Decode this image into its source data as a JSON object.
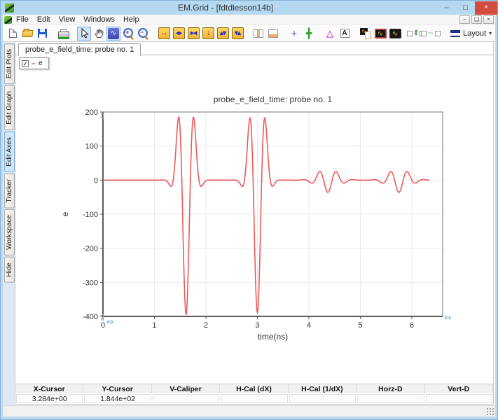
{
  "window": {
    "title": "EM.Grid - [fdtdlesson14b]",
    "controls": {
      "minimize": "–",
      "maximize": "□",
      "close": "×"
    }
  },
  "menubar": {
    "items": [
      "File",
      "Edit",
      "View",
      "Windows",
      "Help"
    ],
    "mdi_controls": {
      "minimize": "–",
      "restore": "❏",
      "close": "×"
    }
  },
  "toolbar": {
    "layout_label": "Layout",
    "layout_caret": "▾",
    "icons": [
      {
        "name": "new-file-icon",
        "kind": "page"
      },
      {
        "name": "open-file-icon",
        "kind": "folder"
      },
      {
        "name": "save-icon",
        "kind": "floppy"
      },
      {
        "name": "print-icon",
        "kind": "printer",
        "gap": true
      },
      {
        "name": "select-cursor-icon",
        "kind": "svg-cursor",
        "selected": true,
        "gap": true
      },
      {
        "name": "pan-hand-icon",
        "kind": "svg-hand"
      },
      {
        "name": "zoom-region-icon",
        "kind": "wavebox",
        "glyph": "∿",
        "selected": true
      },
      {
        "name": "zoom-in-icon",
        "kind": "zoom",
        "glyph": "+"
      },
      {
        "name": "zoom-out-icon",
        "kind": "zoom",
        "glyph": "−"
      },
      {
        "name": "expand-x-icon",
        "kind": "yl",
        "glyph": "↔",
        "color": "#c42222",
        "gap": true
      },
      {
        "name": "shrink-x-icon",
        "kind": "yl",
        "glyph": "◂▸",
        "color": "#2233bb"
      },
      {
        "name": "compress-x-icon",
        "kind": "yl",
        "glyph": "▸◂",
        "color": "#2233bb"
      },
      {
        "name": "expand-y-icon",
        "kind": "yl",
        "glyph": "↕",
        "color": "#c42222"
      },
      {
        "name": "shrink-y-icon",
        "kind": "yl",
        "glyph": "▴▾",
        "color": "#2233bb"
      },
      {
        "name": "compress-y-icon",
        "kind": "yl",
        "glyph": "▾▴",
        "color": "#2233bb"
      },
      {
        "name": "split-vertical-icon",
        "kind": "splitv",
        "gap": true
      },
      {
        "name": "split-horizontal-icon",
        "kind": "splith"
      },
      {
        "name": "add-marker-icon",
        "kind": "plain",
        "glyph": "+",
        "color": "#8484cc",
        "gap": true
      },
      {
        "name": "axes-cursor-icon",
        "kind": "plain",
        "glyph": "╋",
        "color": "#2f9e2f"
      },
      {
        "name": "delta-marker-icon",
        "kind": "plain",
        "glyph": "△",
        "color": "#e060c0",
        "gap": true
      },
      {
        "name": "text-annotation-icon",
        "kind": "abox",
        "glyph": "A"
      },
      {
        "name": "subplot-icon",
        "kind": "subplot",
        "gap": true
      },
      {
        "name": "plot-style-active-icon",
        "kind": "darkplot",
        "glyph": "∿",
        "selectedRed": true
      },
      {
        "name": "plot-style-icon",
        "kind": "darkplot",
        "glyph": "∿"
      },
      {
        "name": "distribute-vertical-icon",
        "kind": "dist",
        "glyph": "⇕",
        "gap": true
      },
      {
        "name": "distribute-horizontal-icon",
        "kind": "dist",
        "glyph": "⇔"
      }
    ]
  },
  "sidebar": {
    "tabs": [
      {
        "label": "Edit Plots",
        "selected": false
      },
      {
        "label": "Edit Graph",
        "selected": false
      },
      {
        "label": "Edit Axes",
        "selected": true
      },
      {
        "label": "Tracker",
        "selected": false
      },
      {
        "label": "Workspace",
        "selected": false
      },
      {
        "label": "Hide",
        "selected": false
      }
    ]
  },
  "tabbar": {
    "tabs": [
      {
        "label": "probe_e_field_time: probe no. 1",
        "selected": true
      }
    ]
  },
  "legend": {
    "checkbox_checked": true,
    "check_glyph": "✓",
    "dash_glyph": "–",
    "series_label": "e",
    "series_color": "#ee5a5a"
  },
  "chart_data": {
    "type": "line",
    "title": "probe_e_field_time: probe no. 1",
    "xlabel": "time(ns)",
    "ylabel": "e",
    "xlim": [
      0,
      6.6
    ],
    "ylim": [
      -400,
      200
    ],
    "xticks": [
      0,
      1,
      2,
      3,
      4,
      5,
      6
    ],
    "yticks": [
      200,
      100,
      0,
      -100,
      -200,
      -300,
      -400
    ],
    "grid": true,
    "grid_color": "#ebebeb",
    "frame_color": "#8a8a8a",
    "handle_color": "#74aede",
    "legend_position": "top-left-floating",
    "series": [
      {
        "name": "e",
        "color": "#ee5a5a",
        "t_range": [
          0,
          6.35
        ],
        "pulse_model": {
          "formula": "y(t) = sum_i trough_i * cos(2*pi*freq_i*(t-center_i)) * exp(-((t-center_i)/sigma_i)^2)",
          "pulses": [
            {
              "center": 1.615,
              "trough": -395,
              "freq": 3.0,
              "sigma": 0.177
            },
            {
              "center": 3.0,
              "trough": -390,
              "freq": 3.0,
              "sigma": 0.177
            },
            {
              "center": 4.37,
              "trough": -36,
              "freq": 3.0,
              "sigma": 0.27
            },
            {
              "center": 5.75,
              "trough": -36,
              "freq": 3.0,
              "sigma": 0.27
            }
          ]
        },
        "key_points": [
          [
            0,
            0
          ],
          [
            1.25,
            -11
          ],
          [
            1.45,
            162
          ],
          [
            1.615,
            -395
          ],
          [
            1.78,
            166
          ],
          [
            1.95,
            -11
          ],
          [
            2.5,
            0
          ],
          [
            2.83,
            152
          ],
          [
            3.0,
            -390
          ],
          [
            3.17,
            173
          ],
          [
            3.33,
            -11
          ],
          [
            4.0,
            0
          ],
          [
            4.2,
            20
          ],
          [
            4.37,
            -36
          ],
          [
            4.54,
            28
          ],
          [
            4.7,
            -8
          ],
          [
            5.2,
            0
          ],
          [
            5.58,
            20
          ],
          [
            5.75,
            -36
          ],
          [
            5.92,
            30
          ],
          [
            6.08,
            -8
          ],
          [
            6.35,
            0
          ]
        ]
      }
    ]
  },
  "statusbar": {
    "columns": [
      {
        "label": "X-Cursor",
        "value": "3.284e+00"
      },
      {
        "label": "Y-Cursor",
        "value": "1.844e+02"
      },
      {
        "label": "V-Caliper",
        "value": ""
      },
      {
        "label": "H-Cal (dX)",
        "value": ""
      },
      {
        "label": "H-Cal (1/dX)",
        "value": ""
      },
      {
        "label": "Horz-D",
        "value": ""
      },
      {
        "label": "Vert-D",
        "value": ""
      }
    ]
  }
}
